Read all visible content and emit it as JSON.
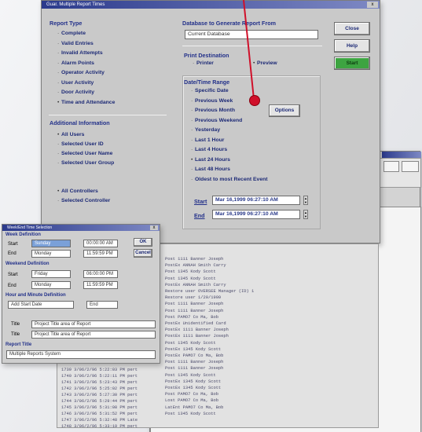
{
  "main_window": {
    "title": "Guar. Multiple Report Times",
    "close": "x"
  },
  "report_type": {
    "heading": "Report Type",
    "items": [
      "Complete",
      "Valid Entries",
      "Invalid Attempts",
      "Alarm Points",
      "Operator Activity",
      "User Activity",
      "Door Activity",
      "Time and Attendance"
    ]
  },
  "additional_info": {
    "heading": "Additional Information",
    "user_items": [
      "All Users",
      "Selected User ID",
      "Selected User Name",
      "Selected User Group"
    ],
    "controller_items": [
      "All Controllers",
      "Selected Controller"
    ]
  },
  "database": {
    "heading": "Database to Generate Report From",
    "value": "Current Database"
  },
  "print_destination": {
    "heading": "Print Destination",
    "options": [
      "Printer",
      "Preview"
    ]
  },
  "date_range": {
    "heading": "Date/Time Range",
    "items": [
      "Specific Date",
      "Previous Week",
      "Previous Month",
      "Previous Weekend",
      "Yesterday",
      "Last 1 Hour",
      "Last 4 Hours",
      "Last 24 Hours",
      "Last 48 Hours",
      "Oldest to most Recent Event"
    ],
    "options_button": "Options",
    "start_label": "Start",
    "end_label": "End",
    "start_value": "Mar 16,1999 06:27:10 AM",
    "end_value": "Mar 16,1999 06:27:10 AM"
  },
  "buttons": {
    "close": "Close",
    "help": "Help",
    "start": "Start"
  },
  "small_dialog": {
    "title": "Week/End Time Selection",
    "week_heading": "Week Definition",
    "weekend_heading": "Weekend Definition",
    "time_heading": "Hour and Minute Definition",
    "report_title_heading": "Report Title",
    "start_label": "Start",
    "end_label": "End",
    "week_start_day": "Sunday",
    "week_end_day": "Monday",
    "weekend_start_day": "Friday",
    "weekend_end_day": "Monday",
    "time1": "00:00:00 AM",
    "time2": "11:59:59 PM",
    "time3": "06:00:00 PM",
    "time4": "11:59:59 PM",
    "ok": "OK",
    "cancel": "Cancel",
    "report_title_value": "Multiple Reports System",
    "note1": "Add Start Date",
    "note2": "End",
    "row_label": "Title",
    "row_text": "Project Title area of Report",
    "row_label2": "Title",
    "row_text2": "Project Title area of Report"
  },
  "log_lines": [
    "Post    1111  Banner Joseph",
    "PostEx  ANNAH  Smith Carry",
    "Post    1345  Kody Scott",
    "Post    1345  Kody Scott",
    "PostEx  ANNAH  Smith Carry",
    "Restore user OVERSEE Manager (ID) 1",
    "Restore user 1/20/1999",
    "Post    1111  Banner Joseph",
    "Post    1111  Banner Joseph",
    "Post    PAMO7  Co Ma, Bob",
    "PostEx  Unidentified Card",
    "PostEx  1111  Banner Joseph",
    "PostEx  1111  Banner Joseph",
    "Post    1345  Kody Scott",
    "PostEx  1345  Kody Scott",
    "PostEx  PAMO7  Co Ma, Bob",
    "Post    1111  Banner Joseph",
    "Post    1111  Banner Joseph",
    "Post    1345  Kody Scott",
    "PostEx  1345  Kody Scott",
    "PostEx  1345  Kody Scott",
    "Post    PAMO7  Co Ma, Bob",
    "Lost    PAMO7  Co Ma, Bob",
    "LatEnt  PAMO7  Co Ma, Bob",
    "Post    1345  Kody Scott"
  ],
  "log_left": [
    "1739 3/06/2/96  5:22:03 PM   pert",
    "1740 3/06/2/96  5:22:11 PM   pert",
    "1741 3/06/2/96  5:23:43 PM   pert",
    "1742 3/06/2/96  5:25:02 PM   pert",
    "1743 3/06/2/96  5:27:30 PM   pert",
    "1744 3/06/2/96  5:29:44 PM   pert",
    "1745 3/06/2/96  5:31:08 PM   pert",
    "1746 3/06/2/96  5:31:52 PM   pert",
    "1747 3/06/2/96  5:32:48 PM   Late",
    "1748 3/06/2/96  5:33:19 PM   pert"
  ],
  "colors": {
    "accent_green": "#3da441",
    "pin_red": "#d0102a",
    "title_blue": "#2b3a8c"
  }
}
